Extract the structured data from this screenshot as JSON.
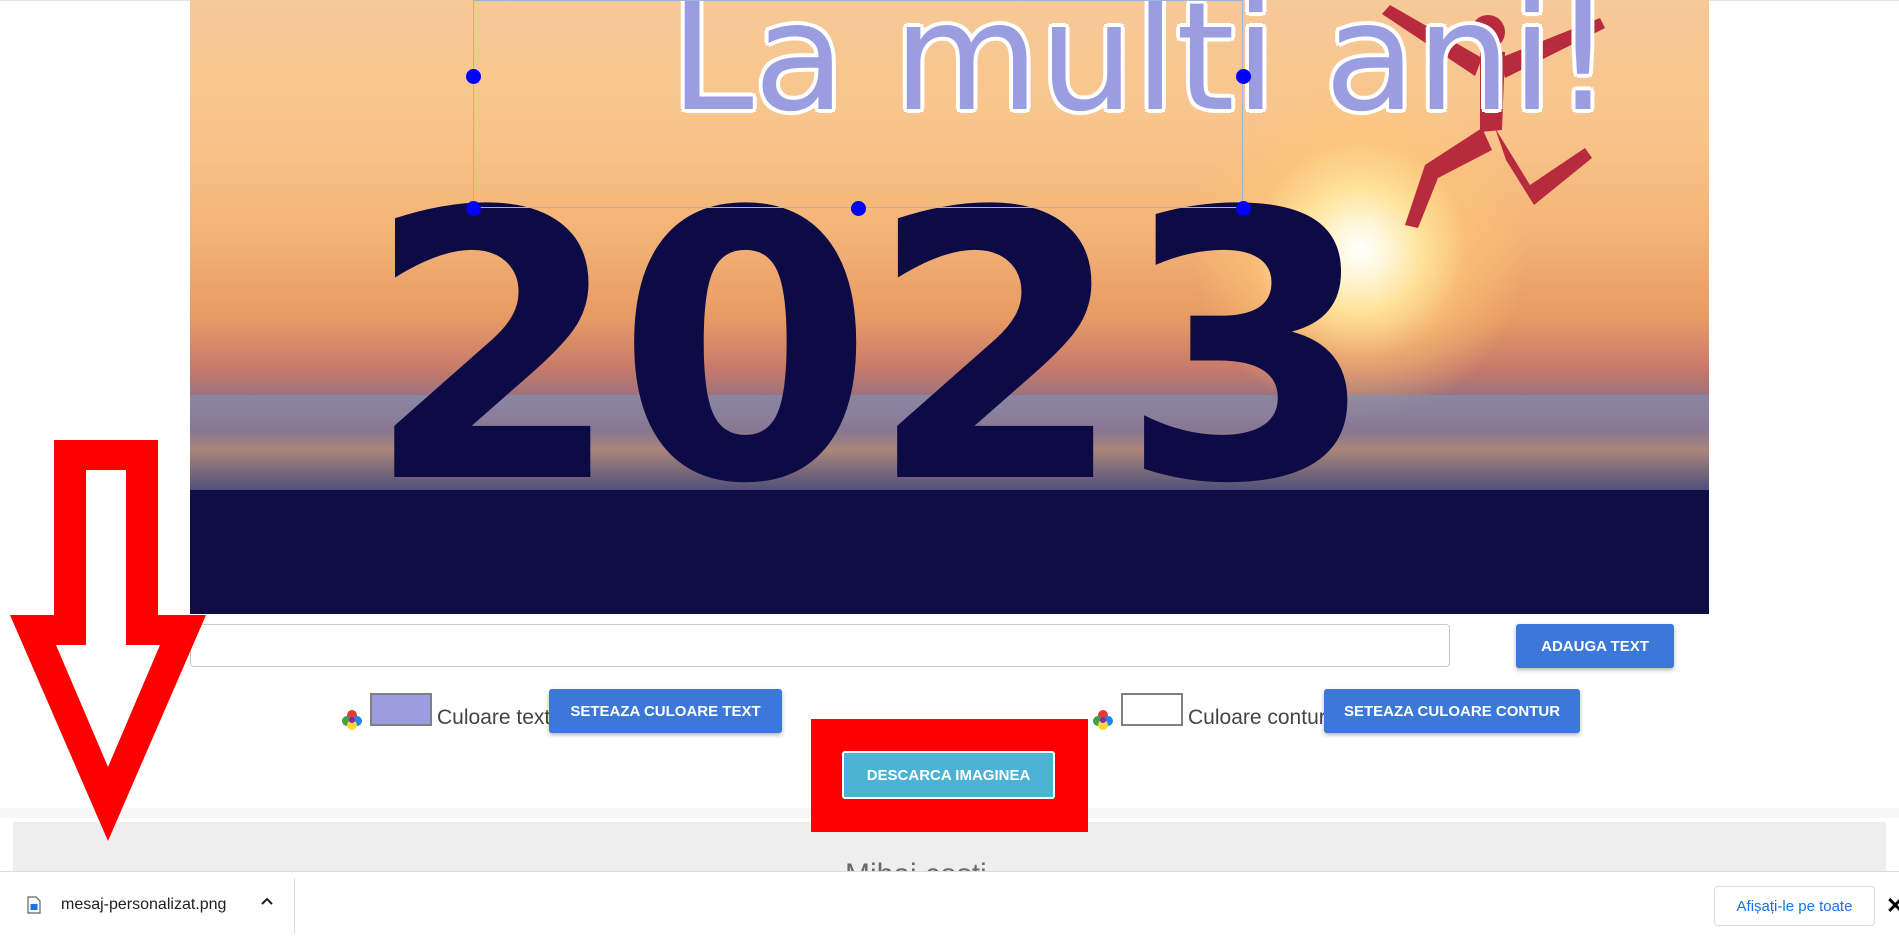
{
  "canvas": {
    "greeting_text": "La multi ani!",
    "year_text": "2023"
  },
  "editor": {
    "text_input_value": "",
    "add_text_label": "ADAUGA TEXT",
    "text_color_label": "Culoare text",
    "set_text_color_label": "SETEAZA CULOARE TEXT",
    "outline_color_label": "Culoare contur",
    "set_outline_color_label": "SETEAZA CULOARE CONTUR",
    "download_label": "DESCARCA IMAGINEA",
    "text_color": "#9a9ee0",
    "outline_color": "#ffffff"
  },
  "footer": {
    "partial_text": "Mihai costi"
  },
  "download_bar": {
    "file_name": "mesaj-personalizat.png",
    "show_all_label": "Afișați-le pe toate",
    "close_symbol": "✕"
  },
  "annotations": {
    "highlight_color": "#ff0000"
  }
}
